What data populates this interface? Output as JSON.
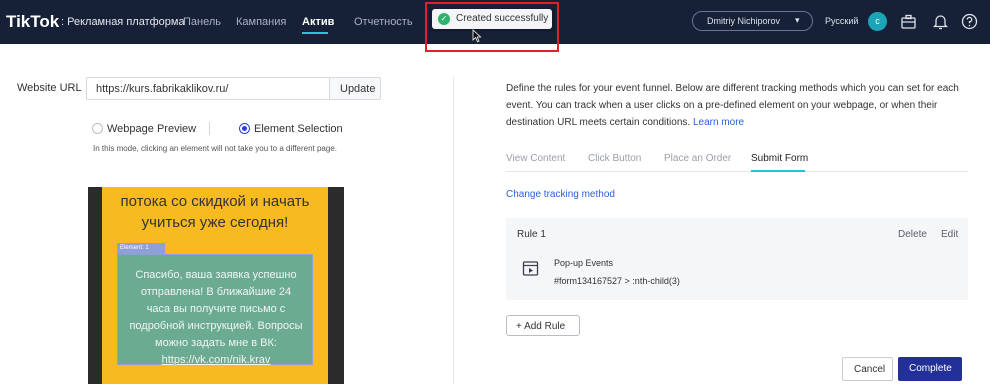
{
  "topbar": {
    "brand": "TikTok",
    "brand_sub": ": Рекламная платформа",
    "nav": [
      {
        "label": "Панель"
      },
      {
        "label": "Кампания"
      },
      {
        "label": "Актив"
      },
      {
        "label": "Отчетность"
      }
    ],
    "active_nav": "Актив",
    "toast": "Created successfully",
    "user": "Dmitriy Nichiporov",
    "language": "Русский",
    "avatar_letter": "c",
    "icons": [
      "briefcase-icon",
      "bell-icon",
      "help-icon"
    ],
    "accent": "#25c5d3",
    "bg": "#162036"
  },
  "left": {
    "url_label": "Website URL",
    "url_value": "https://kurs.fabrikaklikov.ru/",
    "update_label": "Update",
    "radio_preview": "Webpage Preview",
    "radio_selection": "Element Selection",
    "selected_mode": "Element Selection",
    "mode_note": "In this mode, clicking an element will not take you to a different page.",
    "preview": {
      "head_line1": "потока со скидкой и начать",
      "head_line2": "учиться уже сегодня!",
      "element_tag": "Element: 1",
      "text_line1": "Спасибо, ваша заявка успешно",
      "text_line2": "отправлена! В ближайшие 24",
      "text_line3": "часа вы получите письмо с",
      "text_line4": "подробной инструкцией. Вопросы",
      "text_line5": "можно задать мне в ВК:",
      "link": "https://vk.com/nik.krav"
    }
  },
  "right": {
    "intro": "Define the rules for your event funnel. Below are different tracking methods which you can set for each event. You can track when a user clicks on a pre-defined element on your webpage, or when their destination URL meets certain conditions.",
    "learn_more": "Learn more",
    "tabs": [
      {
        "label": "View Content"
      },
      {
        "label": "Click Button"
      },
      {
        "label": "Place an Order"
      },
      {
        "label": "Submit Form"
      }
    ],
    "active_tab": "Submit Form",
    "change_method": "Change tracking method",
    "rule": {
      "title": "Rule 1",
      "delete": "Delete",
      "edit": "Edit",
      "type": "Pop-up Events",
      "selector": "#form134167527 > :nth-child(3)"
    },
    "add_rule": "+ Add Rule",
    "cancel": "Cancel",
    "complete": "Complete",
    "primary_color": "#23309a"
  }
}
